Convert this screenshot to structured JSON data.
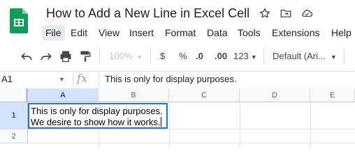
{
  "header": {
    "title": "How to Add a New Line in Excel Cell",
    "icons": {
      "star": "star-icon",
      "move": "move-to-folder-icon",
      "status": "cloud-status-icon"
    },
    "logo_color": "#0f9d58"
  },
  "menu": [
    "File",
    "Edit",
    "View",
    "Insert",
    "Format",
    "Data",
    "Tools",
    "Extensions",
    "Help"
  ],
  "toolbar": {
    "icons": [
      "undo-icon",
      "redo-icon",
      "print-icon",
      "paint-format-icon"
    ],
    "zoom": "100%",
    "currency": "$",
    "percent": "%",
    "decrease_decimal": ".0",
    "increase_decimal": ".00",
    "more_formats": "123",
    "font": "Default (Ari..."
  },
  "formula_bar": {
    "name_box": "A1",
    "fx": "fx",
    "content": "This is only for display purposes."
  },
  "grid": {
    "columns": [
      "A",
      "B",
      "C",
      "D",
      "E"
    ],
    "rows": [
      "1",
      "2"
    ],
    "selected_cell": "A1",
    "a1_lines": [
      "This is only for display purposes.",
      "We desire to show how it works."
    ]
  },
  "colors": {
    "accent": "#1a73e8",
    "header_selected": "#d3e3fd"
  }
}
